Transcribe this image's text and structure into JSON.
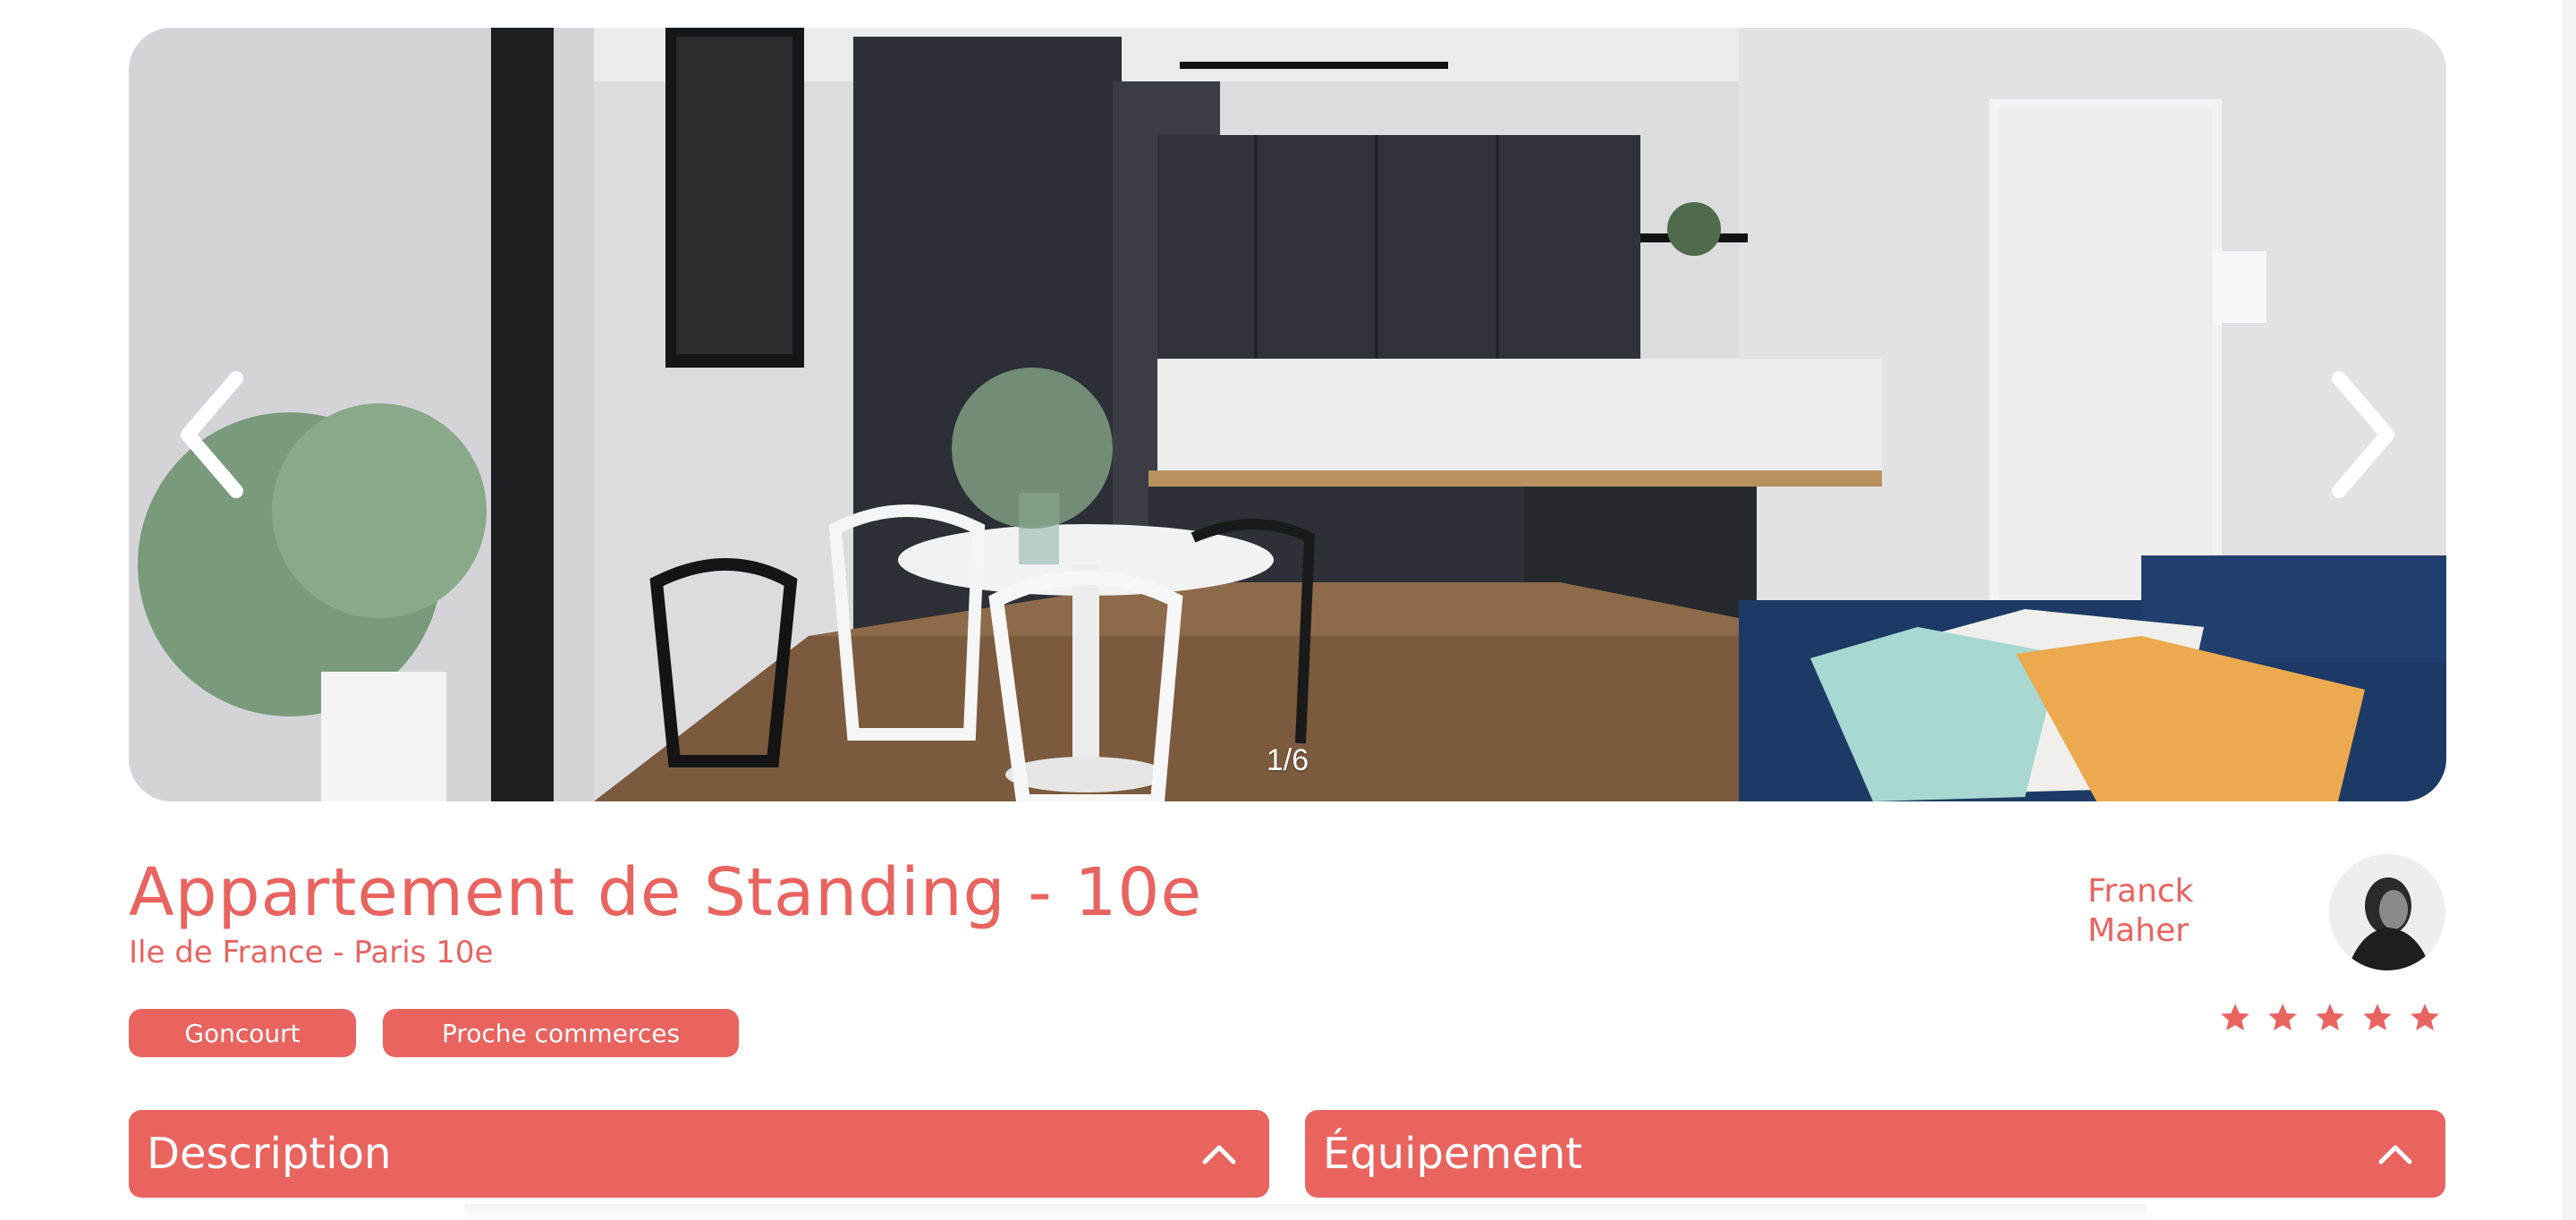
{
  "gallery": {
    "counter": "1/6",
    "current_index": 1,
    "total": 6
  },
  "listing": {
    "title": "Appartement de Standing - 10e",
    "location": "Ile de France - Paris 10e",
    "tags": [
      "Goncourt",
      "Proche commerces"
    ]
  },
  "host": {
    "first_name": "Franck",
    "last_name": "Maher"
  },
  "rating": {
    "value": 5,
    "max": 5
  },
  "sections": {
    "description_label": "Description",
    "equipment_label": "Équipement"
  },
  "colors": {
    "accent": "#e9635f",
    "star_active": "#e9635f",
    "star_inactive": "#e3e3e3",
    "background": "#ffffff"
  },
  "icons": {
    "prev": "chevron-left-icon",
    "next": "chevron-right-icon",
    "collapse": "chevron-up-icon",
    "star": "star-icon"
  }
}
